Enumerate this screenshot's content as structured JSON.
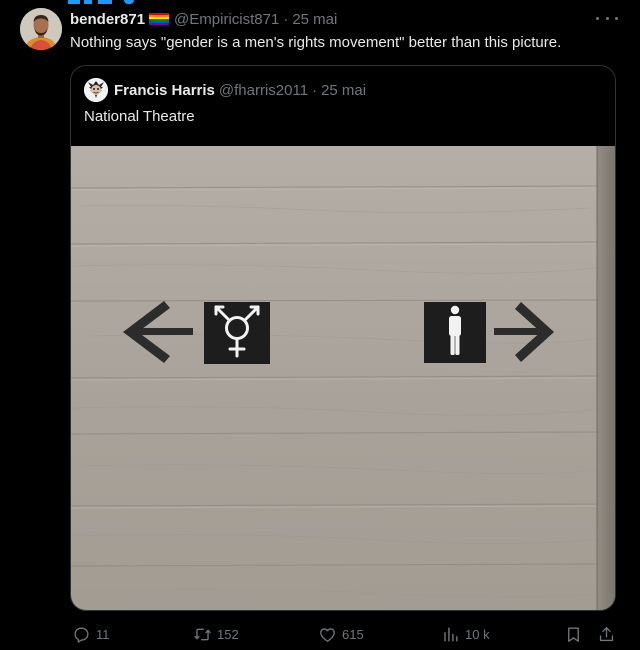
{
  "post": {
    "display_name": "bender871",
    "flag_icon": "rainbow-flag-icon",
    "flag_colors": [
      "#e40303",
      "#ff8c00",
      "#ffed00",
      "#008026",
      "#004dff",
      "#750787"
    ],
    "handle": "@Empiricist871",
    "separator": "·",
    "date": "25 mai",
    "text": "Nothing says \"gender is a men's rights movement\" better than this picture.",
    "more_icon": "more-icon"
  },
  "quote": {
    "display_name": "Francis Harris",
    "handle": "@fharris2011",
    "separator": "·",
    "date": "25 mai",
    "text": "National Theatre"
  },
  "actions": {
    "reply": {
      "icon": "reply-icon",
      "count": "11"
    },
    "repost": {
      "icon": "repost-icon",
      "count": "152"
    },
    "like": {
      "icon": "heart-icon",
      "count": "615"
    },
    "views": {
      "icon": "views-icon",
      "count": "10 k"
    },
    "bookmark": {
      "icon": "bookmark-icon"
    },
    "share": {
      "icon": "share-icon"
    }
  },
  "colors": {
    "background": "#000000",
    "text": "#e7e9ea",
    "muted": "#71767b",
    "border": "#2f3336",
    "accent": "#1d9bf0"
  }
}
